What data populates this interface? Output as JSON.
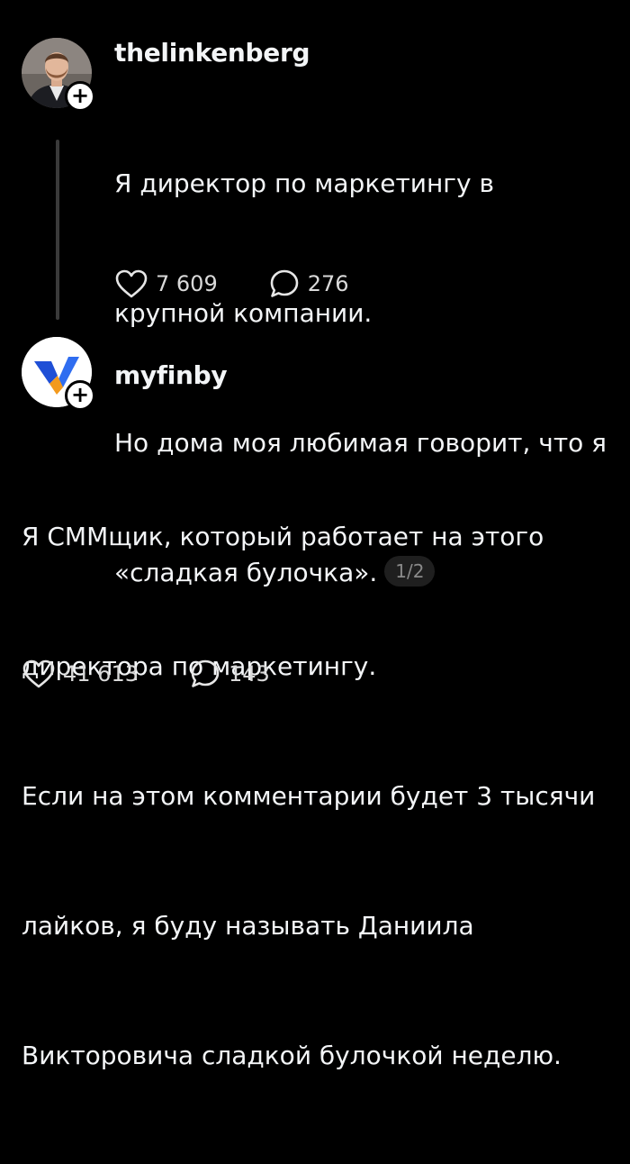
{
  "posts": [
    {
      "username": "thelinkenberg",
      "text": "Я директор по маркетингу в крупной компании.\nНо дома моя любимая говорит, что я «сладкая булочка».",
      "text_lines": [
        "Я директор по маркетингу в",
        "крупной компании.",
        "Но дома моя любимая говорит, что я",
        "«сладкая булочка»."
      ],
      "page_indicator": "1/2",
      "likes": "7 609",
      "replies": "276",
      "follow_symbol": "+"
    },
    {
      "username": "myfinby",
      "text_lines": [
        "Я СММщик, который работает на этого",
        "директора по маркетингу.",
        "Если на этом комментарии будет 3 тысячи",
        "лайков, я буду называть Даниила",
        "Викторовича сладкой булочкой неделю."
      ],
      "likes": "41 613",
      "replies": "143",
      "follow_symbol": "+"
    }
  ],
  "colors": {
    "background": "#000000",
    "text": "#f3f5f7",
    "muted": "#8a8a8a",
    "thread_line": "#3a3a3a",
    "brand_blue": "#1f4fd6",
    "brand_orange": "#f39a1e"
  },
  "icons": {
    "like": "heart-icon",
    "reply": "speech-bubble-icon",
    "follow": "plus-icon"
  }
}
